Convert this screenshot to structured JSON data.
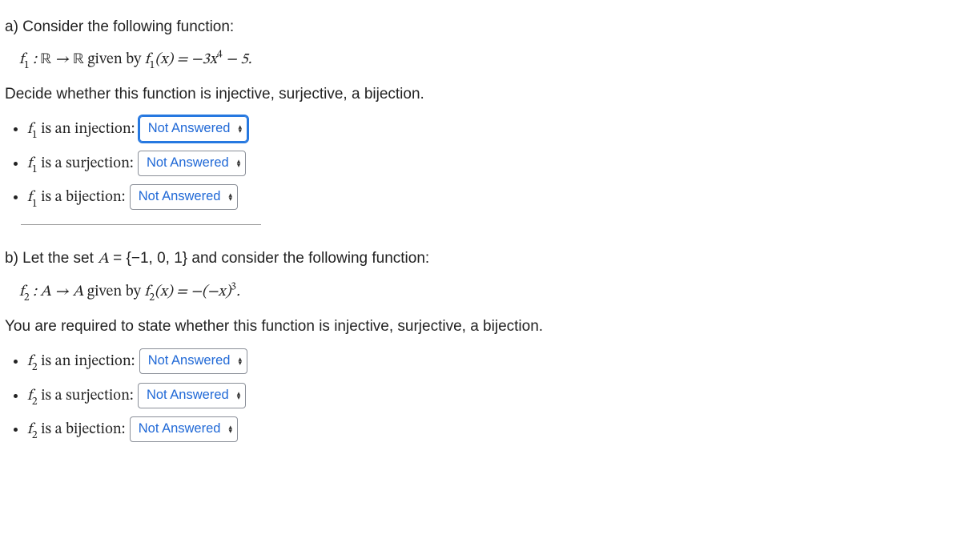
{
  "partA": {
    "intro": "a) Consider the following function:",
    "defn_html": "f<sub>1</sub> : <span class='bb'>ℝ</span> → <span class='bb'>ℝ</span> <span class='rm'>given by</span> f<sub>1</sub>(x) = −3x<sup>4</sup> − 5.",
    "task": "Decide whether this function is injective, surjective, a bijection.",
    "items": [
      {
        "label_html": "f<sub>1</sub> <span class='rm'>is an injection:</span>",
        "value": "Not Answered",
        "focused": true
      },
      {
        "label_html": "f<sub>1</sub> <span class='rm'>is a surjection:</span>",
        "value": "Not Answered",
        "focused": false
      },
      {
        "label_html": "f<sub>1</sub> <span class='rm'>is a bijection:</span>",
        "value": "Not Answered",
        "focused": false
      }
    ]
  },
  "partB": {
    "intro_html": "b) Let the set <span class='math'>A</span> = {−1, 0, 1} and consider the following function:",
    "defn_html": "f<sub>2</sub> : A → A <span class='rm'>given by</span> f<sub>2</sub>(x) = −(−x)<sup>3</sup>.",
    "task": "You are required to state whether this function is injective, surjective, a bijection.",
    "items": [
      {
        "label_html": "f<sub>2</sub> <span class='rm'>is an injection:</span>",
        "value": "Not Answered",
        "focused": false
      },
      {
        "label_html": "f<sub>2</sub> <span class='rm'>is a surjection:</span>",
        "value": "Not Answered",
        "focused": false
      },
      {
        "label_html": "f<sub>2</sub> <span class='rm'>is a bijection:</span>",
        "value": "Not Answered",
        "focused": false
      }
    ]
  }
}
